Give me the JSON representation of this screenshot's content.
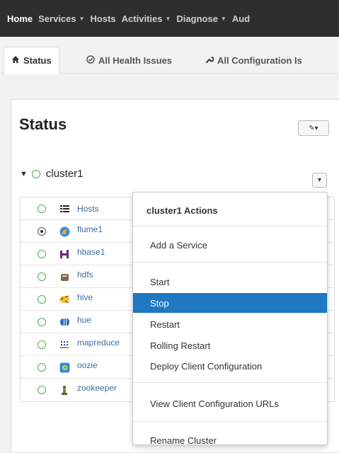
{
  "topnav": {
    "items": [
      {
        "label": "Home",
        "active": true,
        "dropdown": false
      },
      {
        "label": "Services",
        "active": false,
        "dropdown": true
      },
      {
        "label": "Hosts",
        "active": false,
        "dropdown": false
      },
      {
        "label": "Activities",
        "active": false,
        "dropdown": true
      },
      {
        "label": "Diagnose",
        "active": false,
        "dropdown": true
      },
      {
        "label": "Aud",
        "active": false,
        "dropdown": false
      }
    ]
  },
  "tabs": [
    {
      "label": "Status",
      "icon": "home-icon"
    },
    {
      "label": "All Health Issues",
      "icon": "health-icon"
    },
    {
      "label": "All Configuration Is",
      "icon": "wrench-icon"
    }
  ],
  "status": {
    "title": "Status",
    "edit_button": "✎▾"
  },
  "cluster": {
    "name": "cluster1",
    "actions_button": "▾"
  },
  "services": [
    {
      "name": "Hosts",
      "icon": "hosts-list-icon",
      "status": "ok"
    },
    {
      "name": "flume1",
      "icon": "flume-icon",
      "status": "running"
    },
    {
      "name": "hbase1",
      "icon": "hbase-icon",
      "status": "ok"
    },
    {
      "name": "hdfs",
      "icon": "hdfs-icon",
      "status": "ok"
    },
    {
      "name": "hive",
      "icon": "hive-icon",
      "status": "ok"
    },
    {
      "name": "hue",
      "icon": "hue-icon",
      "status": "ok"
    },
    {
      "name": "mapreduce",
      "icon": "mapreduce-icon",
      "status": "ok"
    },
    {
      "name": "oozie",
      "icon": "oozie-icon",
      "status": "ok"
    },
    {
      "name": "zookeeper",
      "icon": "zookeeper-icon",
      "status": "ok"
    }
  ],
  "menu": {
    "header": "cluster1 Actions",
    "items": [
      {
        "label": "Add a Service"
      },
      {
        "label": "Start"
      },
      {
        "label": "Stop"
      },
      {
        "label": "Restart"
      },
      {
        "label": "Rolling Restart"
      },
      {
        "label": "Deploy Client Configuration"
      },
      {
        "label": "View Client Configuration URLs"
      },
      {
        "label": "Rename Cluster"
      }
    ],
    "highlighted": "Stop"
  },
  "colors": {
    "topnav_bg": "#2e2e2e",
    "status_ok": "#4caf50",
    "link": "#3b6ea5",
    "menu_highlight": "#1e78c2"
  }
}
